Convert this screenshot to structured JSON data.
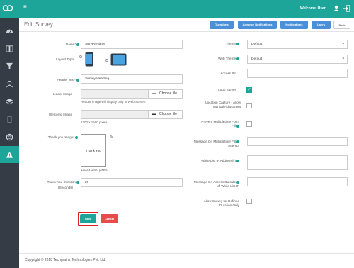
{
  "topbar": {
    "welcome": "Welcome, User"
  },
  "header": {
    "title": "Edit Survey",
    "buttons": [
      "Questions",
      "Advance Notifications",
      "Notifications",
      "Users",
      "Back"
    ]
  },
  "left": {
    "name_label": "Name",
    "name_value": "Survey Name",
    "layout_label": "Layout Type",
    "header_text_label": "Header Text",
    "header_text_value": "Survey Heading",
    "header_image_label": "Header Image",
    "choose_file": "Choose file",
    "header_image_note": "Header image will display only in Web Survey.",
    "welcome_image_label": "Welcome Image",
    "welcome_image_note": "1200 x 1600 pixels",
    "thankyou_image_label": "Thank you Image",
    "thankyou_preview_text": "Thank You",
    "thankyou_image_note": "1200 x 1600 pixels",
    "duration_label": "Thank You Duration",
    "duration_unit": "(Seconds)",
    "duration_value": "20"
  },
  "right": {
    "theme_label": "Theme",
    "theme_value": "Default",
    "web_theme_label": "Web Theme",
    "web_theme_value": "Default",
    "access_pin_label": "Access Pin",
    "loop_survey_label": "Loop Survey",
    "loop_survey_checked": true,
    "location_label_1": "Location Capture - Allow",
    "location_label_2": "Manual Adjustment",
    "prevent_label_1": "Prevent Multipletime Form",
    "prevent_label_2": "Fill",
    "message_multi_label_1": "Message On Multipletime Fill",
    "message_multi_label_2": "Attempt",
    "whitelist_label": "White List IP Address(s)",
    "message_access_label_1": "Message On Access Outside",
    "message_access_label_2": "of White List IP",
    "allow_defined_label_1": "Allow Survey for Defined",
    "allow_defined_label_2": "Duration Only"
  },
  "actions": {
    "save": "Save",
    "cancel": "Cancel"
  },
  "footer": {
    "copyright": "Copyright © 2018 Techgrains Technologies Pvt. Ltd."
  },
  "colors": {
    "teal": "#1ea59a",
    "sidebar": "#353c46",
    "blue": "#4a90d9",
    "red": "#e74c4c"
  }
}
